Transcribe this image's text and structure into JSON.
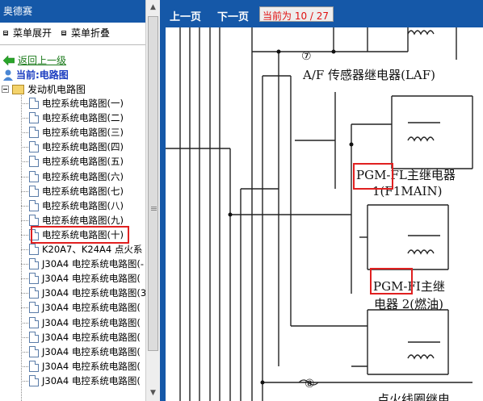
{
  "left_panel": {
    "title": "奥德赛",
    "toolbar": {
      "expand_label": "菜单展开",
      "collapse_label": "菜单折叠"
    },
    "back_label": "返回上一级",
    "current_label": "当前:电路图",
    "root_label": "发动机电路图",
    "items": [
      "电控系统电路图(一)",
      "电控系统电路图(二)",
      "电控系统电路图(三)",
      "电控系统电路图(四)",
      "电控系统电路图(五)",
      "电控系统电路图(六)",
      "电控系统电路图(七)",
      "电控系统电路图(八)",
      "电控系统电路图(九)",
      "电控系统电路图(十)",
      "K20A7、K24A4 点火系",
      "J30A4 电控系统电路图(-",
      "J30A4 电控系统电路图(",
      "J30A4 电控系统电路图(3",
      "J30A4 电控系统电路图(",
      "J30A4 电控系统电路图(",
      "J30A4 电控系统电路图(",
      "J30A4 电控系统电路图(",
      "J30A4 电控系统电路图(",
      "J30A4 电控系统电路图("
    ],
    "selected_index": 9
  },
  "viewer": {
    "prev_label": "上一页",
    "next_label": "下一页",
    "page_indicator": "当前为 10 / 27"
  },
  "diagram": {
    "connector_7": "⑦",
    "laf_label": "A/F 传感器继电器(LAF)",
    "pgm_fl_label": "PGM-FL主继电器",
    "pgm_fl_sub": "1(F1MAIN)",
    "pgm_fi_label": "PGM-FI主继",
    "pgm_fi_sub": "电器 2(燃油)",
    "connector_8": "⑧",
    "ignition_label": "点火线圈继电"
  }
}
